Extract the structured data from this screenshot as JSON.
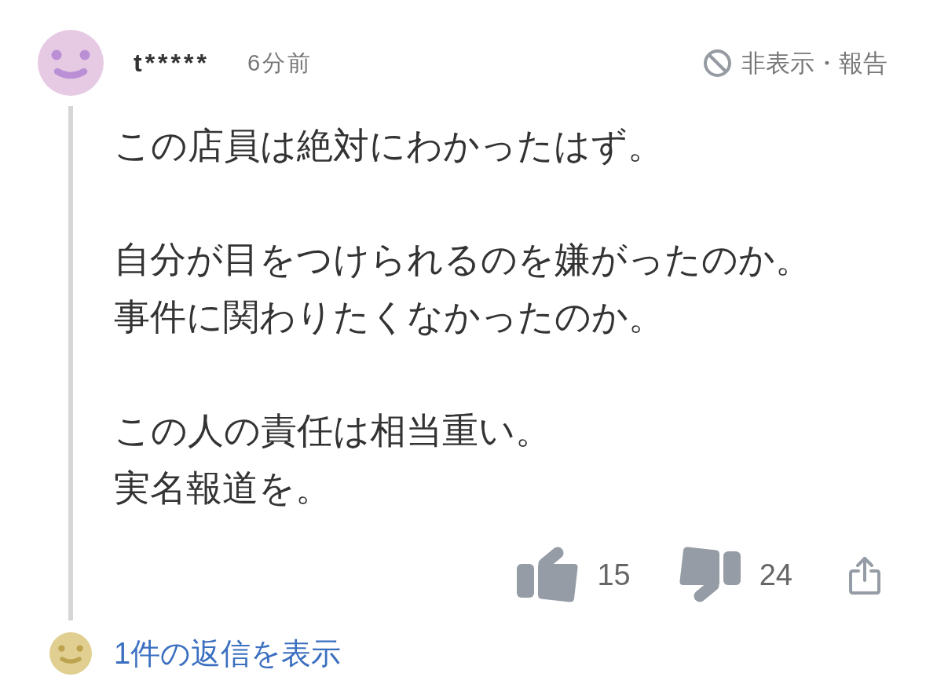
{
  "comment": {
    "user": "t*****",
    "time": "6分前",
    "hide_report": "非表示・報告",
    "paragraphs": [
      [
        "この店員は絶対にわかったはず。"
      ],
      [
        "自分が目をつけられるのを嫌がったのか。",
        "事件に関わりたくなかったのか。"
      ],
      [
        "この人の責任は相当重い。",
        "実名報道を。"
      ]
    ],
    "likes": "15",
    "dislikes": "24"
  },
  "replies": {
    "label": "1件の返信を表示"
  }
}
